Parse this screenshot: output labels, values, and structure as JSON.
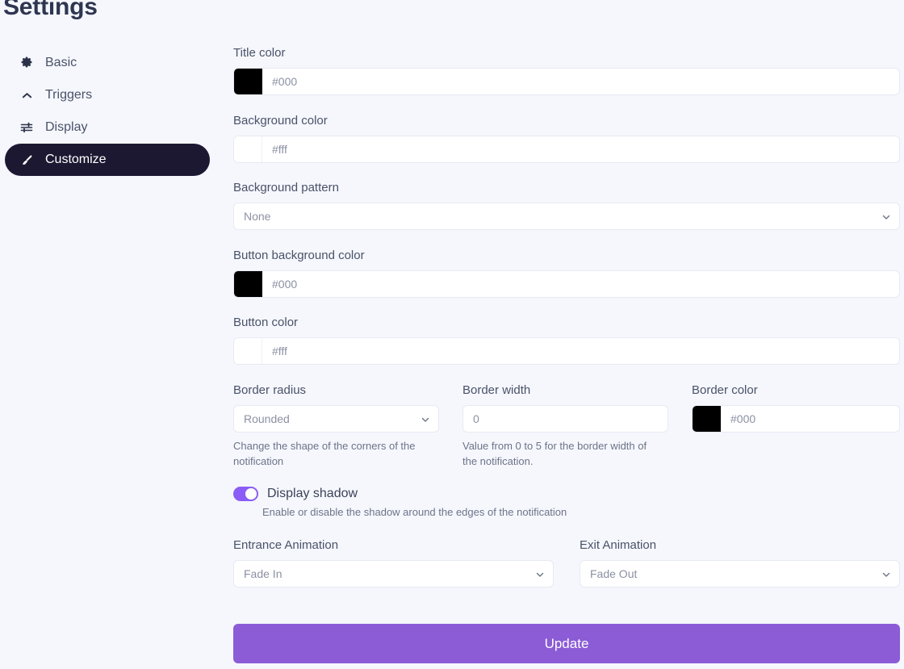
{
  "page": {
    "title": "Settings",
    "background_color": "#f5f7fd"
  },
  "sidebar": {
    "items": [
      {
        "label": "Basic",
        "icon": "gear-icon",
        "active": false
      },
      {
        "label": "Triggers",
        "icon": "chevron-up-icon",
        "active": false
      },
      {
        "label": "Display",
        "icon": "sliders-icon",
        "active": false
      },
      {
        "label": "Customize",
        "icon": "paintbrush-icon",
        "active": true
      }
    ],
    "active_pill_color": "#1d1832"
  },
  "form": {
    "title_color": {
      "label": "Title color",
      "value": "#000",
      "swatch": "#000000"
    },
    "background_color": {
      "label": "Background color",
      "value": "#fff",
      "swatch": "#ffffff"
    },
    "background_pattern": {
      "label": "Background pattern",
      "value": "None",
      "options": [
        "None"
      ]
    },
    "button_background_color": {
      "label": "Button background color",
      "value": "#000",
      "swatch": "#000000"
    },
    "button_color": {
      "label": "Button color",
      "value": "#fff",
      "swatch": "#ffffff"
    },
    "border_radius": {
      "label": "Border radius",
      "value": "Rounded",
      "options": [
        "Rounded"
      ],
      "help": "Change the shape of the corners of the notification"
    },
    "border_width": {
      "label": "Border width",
      "value": "0",
      "help": "Value from 0 to 5 for the border width of the notification."
    },
    "border_color": {
      "label": "Border color",
      "value": "#000",
      "swatch": "#000000"
    },
    "display_shadow": {
      "label": "Display shadow",
      "enabled": true,
      "toggle_color": "#8b5cf6",
      "help": "Enable or disable the shadow around the edges of the notification"
    },
    "entrance_animation": {
      "label": "Entrance Animation",
      "value": "Fade In",
      "options": [
        "Fade In"
      ]
    },
    "exit_animation": {
      "label": "Exit Animation",
      "value": "Fade Out",
      "options": [
        "Fade Out"
      ]
    },
    "submit": {
      "label": "Update",
      "color": "#8b5cd6"
    }
  }
}
